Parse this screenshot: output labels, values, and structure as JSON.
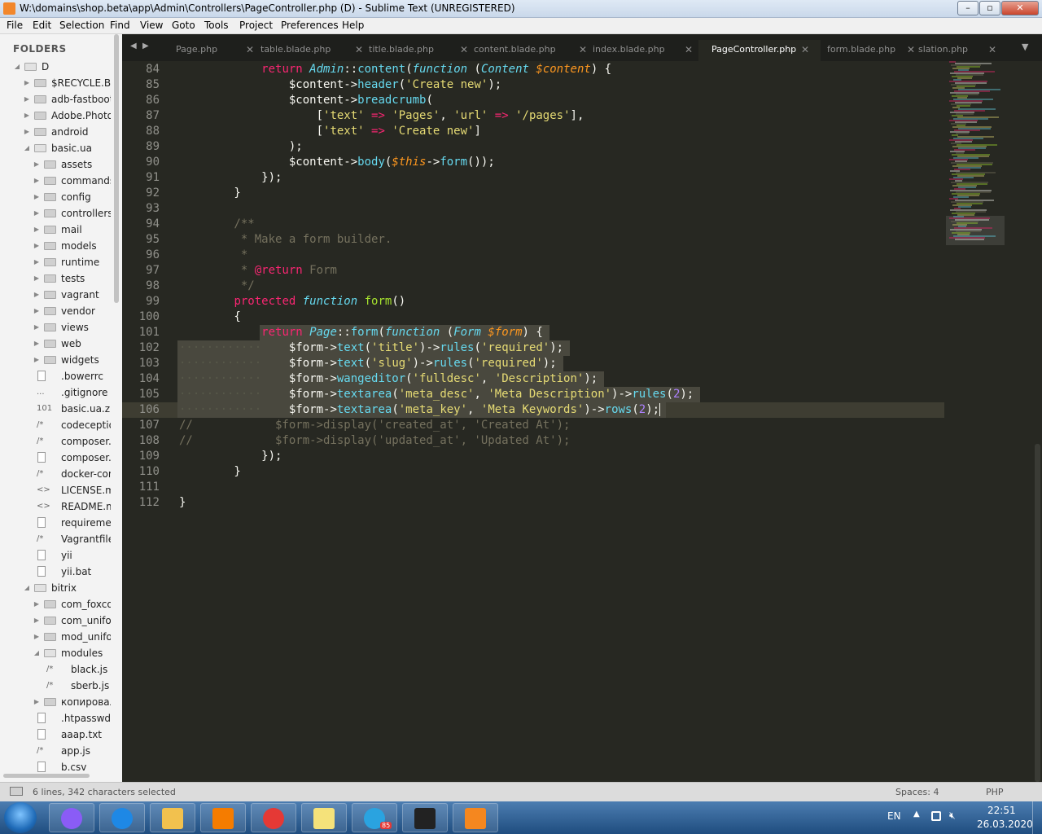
{
  "window": {
    "title": "W:\\domains\\shop.beta\\app\\Admin\\Controllers\\PageController.php (D) - Sublime Text (UNREGISTERED)",
    "minimize": "–",
    "maximize": "▫",
    "close": "✕"
  },
  "menu": [
    "File",
    "Edit",
    "Selection",
    "Find",
    "View",
    "Goto",
    "Tools",
    "Project",
    "Preferences",
    "Help"
  ],
  "sidebar": {
    "header": "FOLDERS",
    "items": [
      {
        "label": "D",
        "depth": 0,
        "type": "folder",
        "open": true
      },
      {
        "label": "$RECYCLE.BIN",
        "depth": 1,
        "type": "folder",
        "open": false
      },
      {
        "label": "adb-fastboot",
        "depth": 1,
        "type": "folder",
        "open": false
      },
      {
        "label": "Adobe.Photoshop",
        "depth": 1,
        "type": "folder",
        "open": false
      },
      {
        "label": "android",
        "depth": 1,
        "type": "folder",
        "open": false
      },
      {
        "label": "basic.ua",
        "depth": 1,
        "type": "folder",
        "open": true
      },
      {
        "label": "assets",
        "depth": 2,
        "type": "folder",
        "open": false
      },
      {
        "label": "commands",
        "depth": 2,
        "type": "folder",
        "open": false
      },
      {
        "label": "config",
        "depth": 2,
        "type": "folder",
        "open": false
      },
      {
        "label": "controllers",
        "depth": 2,
        "type": "folder",
        "open": false
      },
      {
        "label": "mail",
        "depth": 2,
        "type": "folder",
        "open": false
      },
      {
        "label": "models",
        "depth": 2,
        "type": "folder",
        "open": false
      },
      {
        "label": "runtime",
        "depth": 2,
        "type": "folder",
        "open": false
      },
      {
        "label": "tests",
        "depth": 2,
        "type": "folder",
        "open": false
      },
      {
        "label": "vagrant",
        "depth": 2,
        "type": "folder",
        "open": false
      },
      {
        "label": "vendor",
        "depth": 2,
        "type": "folder",
        "open": false
      },
      {
        "label": "views",
        "depth": 2,
        "type": "folder",
        "open": false
      },
      {
        "label": "web",
        "depth": 2,
        "type": "folder",
        "open": false
      },
      {
        "label": "widgets",
        "depth": 2,
        "type": "folder",
        "open": false
      },
      {
        "label": ".bowerrc",
        "depth": 2,
        "type": "file",
        "glyph": ""
      },
      {
        "label": ".gitignore",
        "depth": 2,
        "type": "file",
        "glyph": "..."
      },
      {
        "label": "basic.ua.zip",
        "depth": 2,
        "type": "file",
        "glyph": "101"
      },
      {
        "label": "codeception",
        "depth": 2,
        "type": "file",
        "glyph": "/*"
      },
      {
        "label": "composer.json",
        "depth": 2,
        "type": "file",
        "glyph": "/*"
      },
      {
        "label": "composer.lock",
        "depth": 2,
        "type": "file",
        "glyph": ""
      },
      {
        "label": "docker-compose",
        "depth": 2,
        "type": "file",
        "glyph": "/*"
      },
      {
        "label": "LICENSE.md",
        "depth": 2,
        "type": "file",
        "glyph": "<>"
      },
      {
        "label": "README.md",
        "depth": 2,
        "type": "file",
        "glyph": "<>"
      },
      {
        "label": "requirements",
        "depth": 2,
        "type": "file",
        "glyph": ""
      },
      {
        "label": "Vagrantfile",
        "depth": 2,
        "type": "file",
        "glyph": "/*"
      },
      {
        "label": "yii",
        "depth": 2,
        "type": "file",
        "glyph": ""
      },
      {
        "label": "yii.bat",
        "depth": 2,
        "type": "file",
        "glyph": ""
      },
      {
        "label": "bitrix",
        "depth": 1,
        "type": "folder",
        "open": true
      },
      {
        "label": "com_foxcontact",
        "depth": 2,
        "type": "folder",
        "open": false
      },
      {
        "label": "com_uniform",
        "depth": 2,
        "type": "folder",
        "open": false
      },
      {
        "label": "mod_uniform",
        "depth": 2,
        "type": "folder",
        "open": false
      },
      {
        "label": "modules",
        "depth": 2,
        "type": "folder",
        "open": true
      },
      {
        "label": "black.js",
        "depth": 3,
        "type": "file",
        "glyph": "/*"
      },
      {
        "label": "sberb.js",
        "depth": 3,
        "type": "file",
        "glyph": "/*"
      },
      {
        "label": "копировал",
        "depth": 2,
        "type": "folder",
        "open": false
      },
      {
        "label": ".htpasswd",
        "depth": 2,
        "type": "file",
        "glyph": ""
      },
      {
        "label": "aaap.txt",
        "depth": 2,
        "type": "file",
        "glyph": ""
      },
      {
        "label": "app.js",
        "depth": 2,
        "type": "file",
        "glyph": "/*"
      },
      {
        "label": "b.csv",
        "depth": 2,
        "type": "file",
        "glyph": ""
      }
    ]
  },
  "tabs": [
    {
      "label": "Page.php",
      "active": false
    },
    {
      "label": "table.blade.php",
      "active": false
    },
    {
      "label": "title.blade.php",
      "active": false
    },
    {
      "label": "content.blade.php",
      "active": false
    },
    {
      "label": "index.blade.php",
      "active": false
    },
    {
      "label": "PageController.php",
      "active": true
    },
    {
      "label": "form.blade.php",
      "active": false
    },
    {
      "label": "slation.php",
      "active": false
    }
  ],
  "tab_nav": {
    "prev": "◀",
    "next": "▶",
    "overflow": "▼",
    "close": "✕"
  },
  "editor": {
    "current_line": 106,
    "lines": [
      {
        "n": "84",
        "t": [
          [
            "            ",
            "w"
          ],
          [
            "return",
            "k"
          ],
          [
            " ",
            "w"
          ],
          [
            "Admin",
            "i"
          ],
          [
            "::",
            "w"
          ],
          [
            "content",
            "f"
          ],
          [
            "(",
            "w"
          ],
          [
            "function",
            "i"
          ],
          [
            " (",
            "w"
          ],
          [
            "Content",
            "i"
          ],
          [
            " ",
            "w"
          ],
          [
            "$content",
            "v"
          ],
          [
            ") {",
            "w"
          ]
        ]
      },
      {
        "n": "85",
        "t": [
          [
            "                $content->",
            "w"
          ],
          [
            "header",
            "f"
          ],
          [
            "(",
            "w"
          ],
          [
            "'Create new'",
            "s"
          ],
          [
            ");",
            "w"
          ]
        ]
      },
      {
        "n": "86",
        "t": [
          [
            "                $content->",
            "w"
          ],
          [
            "breadcrumb",
            "f"
          ],
          [
            "(",
            "w"
          ]
        ]
      },
      {
        "n": "87",
        "t": [
          [
            "                    [",
            "w"
          ],
          [
            "'text'",
            "s"
          ],
          [
            " ",
            "w"
          ],
          [
            "=>",
            "k"
          ],
          [
            " ",
            "w"
          ],
          [
            "'Pages'",
            "s"
          ],
          [
            ", ",
            "w"
          ],
          [
            "'url'",
            "s"
          ],
          [
            " ",
            "w"
          ],
          [
            "=>",
            "k"
          ],
          [
            " ",
            "w"
          ],
          [
            "'/pages'",
            "s"
          ],
          [
            "],",
            "w"
          ]
        ]
      },
      {
        "n": "88",
        "t": [
          [
            "                    [",
            "w"
          ],
          [
            "'text'",
            "s"
          ],
          [
            " ",
            "w"
          ],
          [
            "=>",
            "k"
          ],
          [
            " ",
            "w"
          ],
          [
            "'Create new'",
            "s"
          ],
          [
            "]",
            "w"
          ]
        ]
      },
      {
        "n": "89",
        "t": [
          [
            "                );",
            "w"
          ]
        ]
      },
      {
        "n": "90",
        "t": [
          [
            "                $content->",
            "w"
          ],
          [
            "body",
            "f"
          ],
          [
            "(",
            "w"
          ],
          [
            "$this",
            "v"
          ],
          [
            "->",
            "w"
          ],
          [
            "form",
            "f"
          ],
          [
            "());",
            "w"
          ]
        ]
      },
      {
        "n": "91",
        "t": [
          [
            "            });",
            "w"
          ]
        ]
      },
      {
        "n": "92",
        "t": [
          [
            "        }",
            "w"
          ]
        ]
      },
      {
        "n": "93",
        "t": []
      },
      {
        "n": "94",
        "t": [
          [
            "        /**",
            "c"
          ]
        ]
      },
      {
        "n": "95",
        "t": [
          [
            "         * Make a form builder.",
            "c"
          ]
        ]
      },
      {
        "n": "96",
        "t": [
          [
            "         *",
            "c"
          ]
        ]
      },
      {
        "n": "97",
        "t": [
          [
            "         * ",
            "c"
          ],
          [
            "@return",
            "k"
          ],
          [
            " Form",
            "c"
          ]
        ]
      },
      {
        "n": "98",
        "t": [
          [
            "         */",
            "c"
          ]
        ]
      },
      {
        "n": "99",
        "t": [
          [
            "        ",
            "w"
          ],
          [
            "protected",
            "k"
          ],
          [
            " ",
            "w"
          ],
          [
            "function",
            "i"
          ],
          [
            " ",
            "w"
          ],
          [
            "form",
            "n"
          ],
          [
            "()",
            "w"
          ]
        ]
      },
      {
        "n": "100",
        "t": [
          [
            "        {",
            "w"
          ]
        ]
      },
      {
        "n": "101",
        "t": [
          [
            "            ",
            "w"
          ],
          [
            "return",
            "k"
          ],
          [
            " ",
            "w"
          ],
          [
            "Page",
            "i"
          ],
          [
            "::",
            "w"
          ],
          [
            "form",
            "f"
          ],
          [
            "(",
            "w"
          ],
          [
            "function",
            "i"
          ],
          [
            " (",
            "w"
          ],
          [
            "Form",
            "i"
          ],
          [
            " ",
            "w"
          ],
          [
            "$form",
            "v"
          ],
          [
            ") {",
            "w"
          ]
        ]
      },
      {
        "n": "102",
        "t": [
          [
            "············",
            "dots"
          ],
          [
            "    $form->",
            "w"
          ],
          [
            "text",
            "f"
          ],
          [
            "(",
            "w"
          ],
          [
            "'title'",
            "s"
          ],
          [
            ")->",
            "w"
          ],
          [
            "rules",
            "f"
          ],
          [
            "(",
            "w"
          ],
          [
            "'required'",
            "s"
          ],
          [
            ");",
            "w"
          ]
        ]
      },
      {
        "n": "103",
        "t": [
          [
            "············",
            "dots"
          ],
          [
            "    $form->",
            "w"
          ],
          [
            "text",
            "f"
          ],
          [
            "(",
            "w"
          ],
          [
            "'slug'",
            "s"
          ],
          [
            ")->",
            "w"
          ],
          [
            "rules",
            "f"
          ],
          [
            "(",
            "w"
          ],
          [
            "'required'",
            "s"
          ],
          [
            ");",
            "w"
          ]
        ]
      },
      {
        "n": "104",
        "t": [
          [
            "············",
            "dots"
          ],
          [
            "    $form->",
            "w"
          ],
          [
            "wangeditor",
            "f"
          ],
          [
            "(",
            "w"
          ],
          [
            "'fulldesc'",
            "s"
          ],
          [
            ", ",
            "w"
          ],
          [
            "'Description'",
            "s"
          ],
          [
            ");",
            "w"
          ]
        ]
      },
      {
        "n": "105",
        "t": [
          [
            "············",
            "dots"
          ],
          [
            "    $form->",
            "w"
          ],
          [
            "textarea",
            "f"
          ],
          [
            "(",
            "w"
          ],
          [
            "'meta_desc'",
            "s"
          ],
          [
            ", ",
            "w"
          ],
          [
            "'Meta Description'",
            "s"
          ],
          [
            ")->",
            "w"
          ],
          [
            "rules",
            "f"
          ],
          [
            "(",
            "w"
          ],
          [
            "2",
            "p"
          ],
          [
            ");",
            "w"
          ]
        ]
      },
      {
        "n": "106",
        "t": [
          [
            "············",
            "dots"
          ],
          [
            "    $form->",
            "w"
          ],
          [
            "textarea",
            "f"
          ],
          [
            "(",
            "w"
          ],
          [
            "'meta_key'",
            "s"
          ],
          [
            ", ",
            "w"
          ],
          [
            "'Meta Keywords'",
            "s"
          ],
          [
            ")->",
            "w"
          ],
          [
            "rows",
            "f"
          ],
          [
            "(",
            "w"
          ],
          [
            "2",
            "p"
          ],
          [
            ");",
            "w"
          ]
        ]
      },
      {
        "n": "107",
        "t": [
          [
            "//            $form->display('created_at', 'Created At');",
            "c"
          ]
        ]
      },
      {
        "n": "108",
        "t": [
          [
            "//            $form->display('updated_at', 'Updated At');",
            "c"
          ]
        ]
      },
      {
        "n": "109",
        "t": [
          [
            "            });",
            "w"
          ]
        ]
      },
      {
        "n": "110",
        "t": [
          [
            "        }",
            "w"
          ]
        ]
      },
      {
        "n": "111",
        "t": []
      },
      {
        "n": "112",
        "t": [
          [
            "}",
            "w"
          ]
        ]
      }
    ]
  },
  "status": {
    "selection": "6 lines, 342 characters selected",
    "spaces": "Spaces: 4",
    "syntax": "PHP"
  },
  "taskbar": {
    "apps": [
      {
        "name": "alice",
        "color": "#8a5cf6"
      },
      {
        "name": "internet-explorer",
        "color": "#1e88e5"
      },
      {
        "name": "file-explorer",
        "color": "#f2c14e"
      },
      {
        "name": "media-player",
        "color": "#f57c00"
      },
      {
        "name": "chrome",
        "color": "#e53935"
      },
      {
        "name": "sticky-notes",
        "color": "#f5e27a"
      },
      {
        "name": "telegram",
        "color": "#2aa3e0"
      },
      {
        "name": "terminal",
        "color": "#222222"
      },
      {
        "name": "sublime-text",
        "color": "#f5871f"
      }
    ],
    "telegram_badge": "85",
    "language": "EN",
    "time": "22:51",
    "date": "26.03.2020"
  }
}
